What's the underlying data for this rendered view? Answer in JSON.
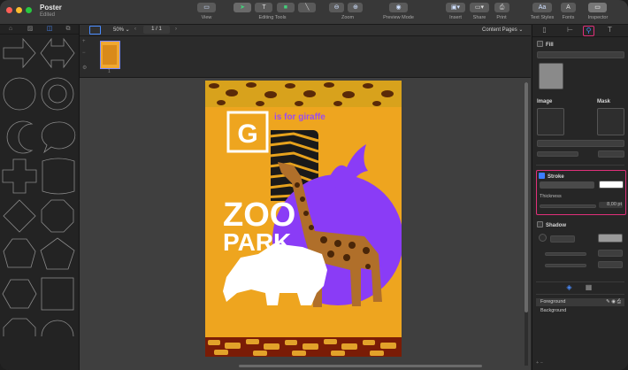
{
  "window": {
    "title": "Poster",
    "subtitle": "Edited"
  },
  "toolbar": {
    "view_label": "View",
    "editing_tools_label": "Editing Tools",
    "zoom_label": "Zoom",
    "preview_label": "Preview Mode",
    "insert_label": "Insert",
    "share_label": "Share",
    "print_label": "Print",
    "text_styles_label": "Text Styles",
    "fonts_label": "Fonts",
    "inspector_label": "Inspector"
  },
  "subbar": {
    "zoom_value": "50%",
    "page_indicator": "1 / 1",
    "pages_mode": "Content Pages"
  },
  "thumbnails": [
    {
      "number": "1"
    }
  ],
  "poster": {
    "letter": "G",
    "tagline": "is for giraffe",
    "headline_1": "ZOO",
    "headline_2": "PARK",
    "colors": {
      "background": "#eea51f",
      "accent_circle": "#8a3cf6",
      "headline": "#ffffff",
      "tagline": "#9b4cf0"
    }
  },
  "inspector": {
    "fill_label": "Fill",
    "image_label": "Image",
    "mask_label": "Mask",
    "stroke_label": "Stroke",
    "thickness_label": "Thickness",
    "thickness_value": "8,00 pt",
    "shadow_label": "Shadow",
    "stroke_checked": true,
    "fill_checked": false,
    "shadow_checked": false
  },
  "layers": [
    {
      "name": "Foreground"
    },
    {
      "name": "Background"
    }
  ]
}
